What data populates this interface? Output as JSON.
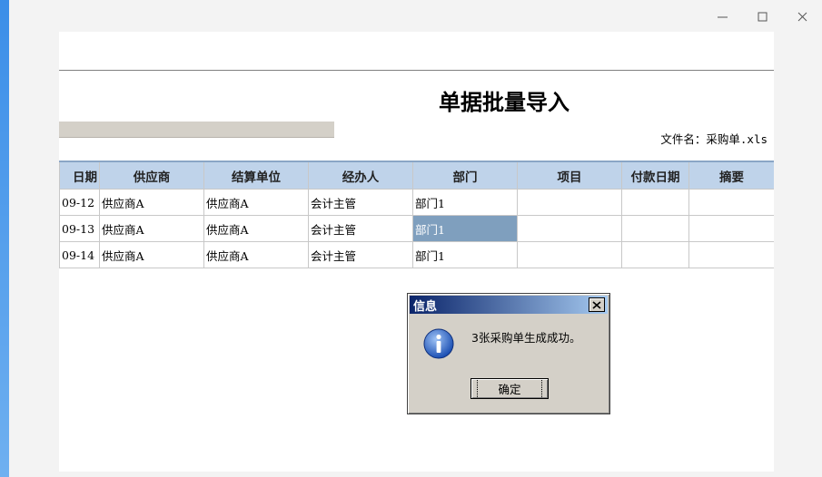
{
  "window": {
    "controls": [
      "minimize-icon",
      "maximize-icon",
      "close-icon"
    ]
  },
  "document": {
    "title": "单据批量导入",
    "filename": "文件名：采购单.xls"
  },
  "table": {
    "columns": [
      "日期",
      "供应商",
      "结算单位",
      "经办人",
      "部门",
      "项目",
      "付款日期",
      "摘要"
    ],
    "rows": [
      {
        "date": "09-12",
        "supplier": "供应商A",
        "settle": "供应商A",
        "handler": "会计主管",
        "dept": "部门1",
        "project": "",
        "paydate": "",
        "memo": ""
      },
      {
        "date": "09-13",
        "supplier": "供应商A",
        "settle": "供应商A",
        "handler": "会计主管",
        "dept": "部门1",
        "project": "",
        "paydate": "",
        "memo": ""
      },
      {
        "date": "09-14",
        "supplier": "供应商A",
        "settle": "供应商A",
        "handler": "会计主管",
        "dept": "部门1",
        "project": "",
        "paydate": "",
        "memo": ""
      }
    ],
    "selected_cell": {
      "row": 1,
      "column": "部门"
    }
  },
  "dialog": {
    "title": "信息",
    "message": "3张采购单生成成功。",
    "ok_label": "确定",
    "icon": "info-icon"
  }
}
